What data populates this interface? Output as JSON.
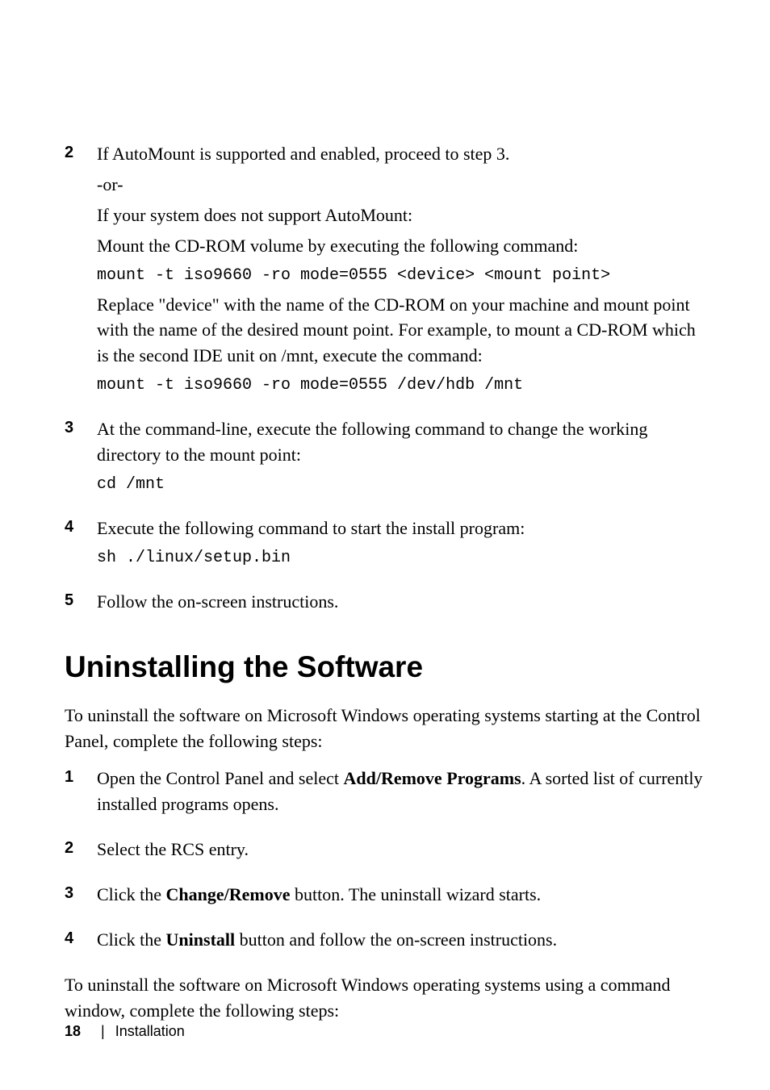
{
  "steps1": [
    {
      "num": "2",
      "lines": [
        {
          "type": "text",
          "content": "If AutoMount is supported and enabled, proceed to step 3."
        },
        {
          "type": "text",
          "content": "-or-"
        },
        {
          "type": "text",
          "content": "If your system does not support AutoMount:"
        },
        {
          "type": "text",
          "content": "Mount the CD-ROM volume by executing the following command:"
        },
        {
          "type": "code",
          "content": "mount -t iso9660 -ro mode=0555 <device> <mount point>"
        },
        {
          "type": "text",
          "content": "Replace \"device\" with the name of the CD-ROM on your machine and mount point with the name of the desired mount point. For example, to mount a CD-ROM which is the second IDE unit on /mnt, execute the command:"
        },
        {
          "type": "code",
          "content": "mount -t iso9660 -ro mode=0555 /dev/hdb /mnt"
        }
      ]
    },
    {
      "num": "3",
      "lines": [
        {
          "type": "text",
          "content": "At the command-line, execute the following command to change the working directory to the mount point:"
        },
        {
          "type": "code",
          "content": "cd /mnt"
        }
      ]
    },
    {
      "num": "4",
      "lines": [
        {
          "type": "text",
          "content": "Execute the following command to start the install program:"
        },
        {
          "type": "code",
          "content": "sh ./linux/setup.bin"
        }
      ]
    },
    {
      "num": "5",
      "lines": [
        {
          "type": "text",
          "content": "Follow the on-screen instructions."
        }
      ]
    }
  ],
  "heading": "Uninstalling the Software",
  "intro": "To uninstall the software on Microsoft Windows operating systems starting at the Control Panel, complete the following steps:",
  "steps2": [
    {
      "num": "1",
      "parts": [
        {
          "text": "Open the Control Panel and select "
        },
        {
          "bold": "Add/Remove Programs"
        },
        {
          "text": ". A sorted list of currently installed programs opens."
        }
      ]
    },
    {
      "num": "2",
      "parts": [
        {
          "text": "Select the RCS entry."
        }
      ]
    },
    {
      "num": "3",
      "parts": [
        {
          "text": "Click the "
        },
        {
          "bold": "Change/Remove"
        },
        {
          "text": " button. The uninstall wizard starts."
        }
      ]
    },
    {
      "num": "4",
      "parts": [
        {
          "text": "Click the "
        },
        {
          "bold": "Uninstall"
        },
        {
          "text": " button and follow the on-screen instructions."
        }
      ]
    }
  ],
  "outro": "To uninstall the software on Microsoft Windows operating systems using a command window, complete the following steps:",
  "footer": {
    "page": "18",
    "section": "Installation"
  }
}
